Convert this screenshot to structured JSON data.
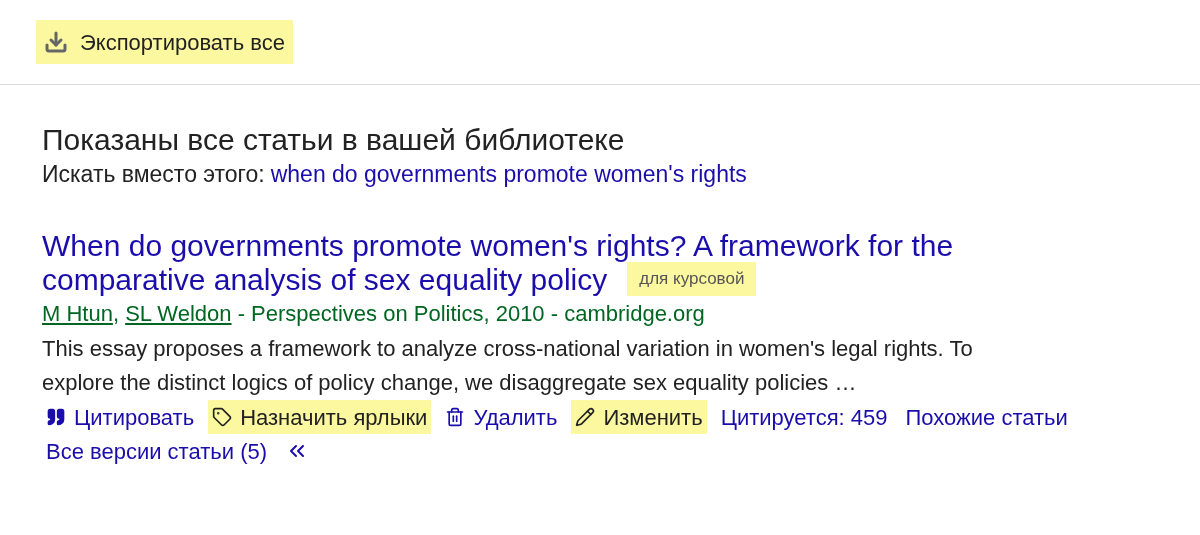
{
  "toolbar": {
    "export_button": {
      "label": "Экспортировать все",
      "highlighted": true
    }
  },
  "heading": "Показаны все статьи в вашей библиотеке",
  "search_instead": {
    "label": "Искать вместо этого:",
    "link": "when do governments promote women's rights"
  },
  "result": {
    "title_lines": [
      "When do governments promote women's rights? A framework for the",
      "comparative analysis of sex equality policy"
    ],
    "label_chip": {
      "text": "для курсовой",
      "highlighted": true
    },
    "authors": [
      "M Htun",
      "SL Weldon"
    ],
    "author_separator": ", ",
    "source": " - Perspectives on Politics, 2010 - cambridge.org",
    "snippet": "This essay proposes a framework to analyze cross-national variation in women's legal rights. To explore the distinct logics of policy change, we disaggregate sex equality policies …",
    "actions": [
      {
        "kind": "cite",
        "label": "Цитировать",
        "highlighted": false
      },
      {
        "kind": "label",
        "label": "Назначить ярлыки",
        "highlighted": true
      },
      {
        "kind": "delete",
        "label": "Удалить",
        "highlighted": false
      },
      {
        "kind": "edit",
        "label": "Изменить",
        "highlighted": true
      },
      {
        "kind": "text",
        "label": "Цитируется: 459",
        "highlighted": false
      },
      {
        "kind": "text",
        "label": "Похожие статьи",
        "highlighted": false
      },
      {
        "kind": "text",
        "label": "Все версии статьи (5)",
        "highlighted": false
      },
      {
        "kind": "more",
        "highlighted": false
      }
    ]
  }
}
